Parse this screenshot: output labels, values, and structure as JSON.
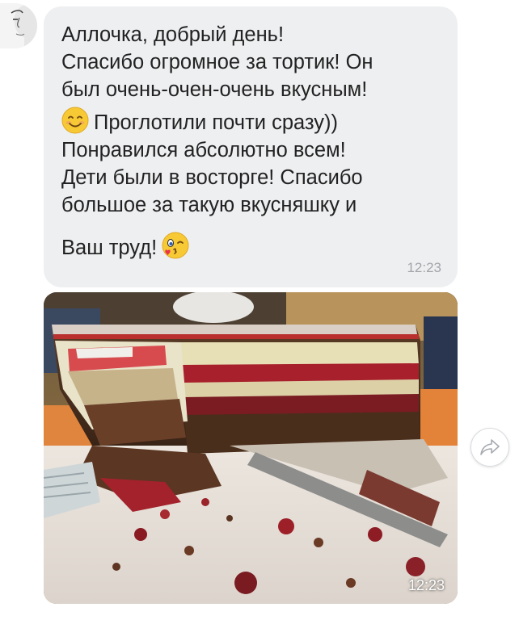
{
  "message": {
    "lines": [
      "Аллочка, добрый день!",
      "Спасибо огромное за тортик! Он",
      "был очень-очен-очень вкусным!",
      "Проглотили почти сразу))",
      "Понравился абсолютно всем!",
      "Дети были в восторге! Спасибо",
      "большое за такую вкусняшку и",
      "Ваш труд!"
    ],
    "time": "12:23"
  },
  "photo": {
    "time": "12:23"
  },
  "icons": {
    "smile": "smiling-face-emoji",
    "kiss": "face-blowing-kiss-emoji",
    "share": "share-arrow-icon"
  },
  "colors": {
    "bubble": "#eeeff1",
    "text": "#222222",
    "time": "#a2a5a9"
  }
}
